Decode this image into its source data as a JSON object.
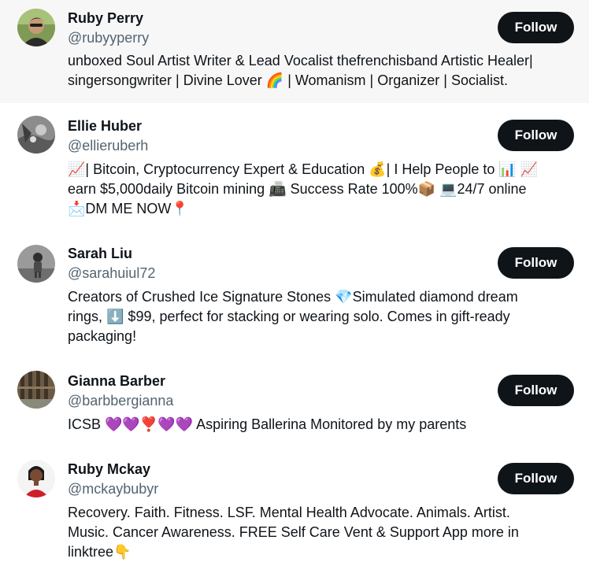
{
  "follow_label": "Follow",
  "users": [
    {
      "name": "Ruby Perry",
      "handle": "@rubyyperry",
      "bio_lines": [
        "unboxed Soul Artist Writer & Lead Vocalist thefrenchisband Artistic Healer|",
        "singersongwriter | Divine Lover 🌈 | Womanism | Organizer | Socialist."
      ]
    },
    {
      "name": "Ellie Huber",
      "handle": "@ellieruberh",
      "bio_lines": [
        "📈| Bitcoin, Cryptocurrency Expert & Education 💰| I Help People to 📊 📈",
        "earn $5,000daily Bitcoin mining 📠 Success Rate 100%📦 💻24/7 online",
        "📩DM ME NOW📍"
      ]
    },
    {
      "name": "Sarah Liu",
      "handle": "@sarahuiul72",
      "bio_lines": [
        "Creators of Crushed Ice Signature Stones 💎Simulated diamond dream",
        "rings, ⬇️ $99, perfect for stacking or wearing solo. Comes in gift-ready",
        "packaging!"
      ]
    },
    {
      "name": "Gianna Barber",
      "handle": "@barbbergianna",
      "bio_lines": [
        "ICSB 💜💜❣️💜💜 Aspiring Ballerina Monitored by my parents"
      ]
    },
    {
      "name": "Ruby Mckay",
      "handle": "@mckaybubyr",
      "bio_lines": [
        "Recovery. Faith. Fitness. LSF. Mental Health Advocate. Animals. Artist.",
        "Music. Cancer Awareness. FREE Self Care Vent & Support App more in",
        "linktree👇"
      ]
    }
  ]
}
